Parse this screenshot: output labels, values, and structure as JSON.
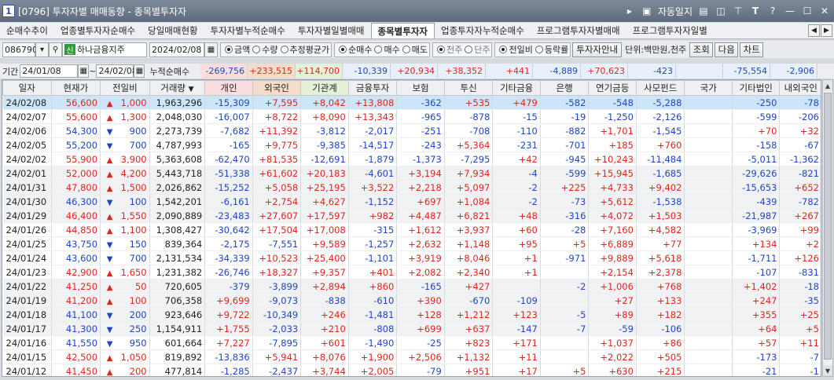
{
  "window": {
    "number": "1",
    "title": "[0796] 투자자별 매매동향 - 종목별투자자",
    "autosave_label": "자동일지",
    "icons": [
      "play-icon",
      "screen-icon",
      "layout-icon",
      "split-icon",
      "pin-icon",
      "font-icon",
      "help-icon",
      "minimize-icon",
      "maximize-icon",
      "close-icon"
    ]
  },
  "tabs": [
    {
      "label": "순매수추이",
      "active": false
    },
    {
      "label": "업종별투자자순매수",
      "active": false
    },
    {
      "label": "당일매매현황",
      "active": false
    },
    {
      "label": "투자자별누적순매수",
      "active": false
    },
    {
      "label": "투자자별일별매매",
      "active": false
    },
    {
      "label": "종목별투자자",
      "active": true
    },
    {
      "label": "업종투자자누적순매수",
      "active": false
    },
    {
      "label": "프로그램투자자별매매",
      "active": false
    },
    {
      "label": "프로그램투자자일별",
      "active": false
    }
  ],
  "controls": {
    "stock_code": "086790",
    "credit_badge": "신",
    "stock_name": "하나금융지주",
    "date": "2024/02/08",
    "value_type": [
      {
        "label": "금액",
        "checked": true
      },
      {
        "label": "수량",
        "checked": false
      },
      {
        "label": "추정평균가",
        "checked": false
      }
    ],
    "trade_type": [
      {
        "label": "순매수",
        "checked": true
      },
      {
        "label": "매수",
        "checked": false
      },
      {
        "label": "매도",
        "checked": false
      }
    ],
    "unit_type": [
      {
        "label": "천주",
        "checked": true
      },
      {
        "label": "단주",
        "checked": false
      }
    ],
    "compare_type": [
      {
        "label": "전일비",
        "checked": true
      },
      {
        "label": "등락률",
        "checked": false
      }
    ],
    "investor_guide_button": "투자자안내",
    "unit_label": "단위:백만원,천주",
    "query_button": "조회",
    "next_button": "다음",
    "chart_button": "차트"
  },
  "period": {
    "label": "기간",
    "start": "24/01/08",
    "separator": "~",
    "end": "24/02/08",
    "cumulative_label": "누적순매수"
  },
  "cumulative": {
    "individual": "-269,756",
    "foreign": "+233,515",
    "institution": "+114,700",
    "financial_investment": "-10,339",
    "insurance": "+20,934",
    "trust": "+38,352",
    "other_finance": "+441",
    "bank": "-4,889",
    "pension": "+70,623",
    "private_fund": "-423",
    "nation": "",
    "other_corp": "-75,554",
    "domestic_foreign": "-2,906"
  },
  "columns": [
    "일자",
    "현재가",
    "전일비",
    "거래량",
    "개인",
    "외국인",
    "기관계",
    "금융투자",
    "보험",
    "투신",
    "기타금융",
    "은행",
    "연기금등",
    "사모펀드",
    "국가",
    "기타법인",
    "내외국인"
  ],
  "rows": [
    {
      "date": "24/02/08",
      "price": "56,600",
      "dir": "up",
      "change": "1,000",
      "volume": "1,963,296",
      "ind": "-15,309",
      "frg": "+7,595",
      "inst": "+8,042",
      "fin": "+13,808",
      "ins": "-362",
      "trust": "+535",
      "ofin": "+479",
      "bank": "-582",
      "pens": "-548",
      "priv": "-5,288",
      "nat": "",
      "ocorp": "-250",
      "dfrg": "-78"
    },
    {
      "date": "24/02/07",
      "price": "55,600",
      "dir": "up",
      "change": "1,300",
      "volume": "2,048,030",
      "ind": "-16,007",
      "frg": "+8,722",
      "inst": "+8,090",
      "fin": "+13,343",
      "ins": "-965",
      "trust": "-878",
      "ofin": "-15",
      "bank": "-19",
      "pens": "-1,250",
      "priv": "-2,126",
      "nat": "",
      "ocorp": "-599",
      "dfrg": "-206"
    },
    {
      "date": "24/02/06",
      "price": "54,300",
      "dir": "down",
      "change": "900",
      "volume": "2,273,739",
      "ind": "-7,682",
      "frg": "+11,392",
      "inst": "-3,812",
      "fin": "-2,017",
      "ins": "-251",
      "trust": "-708",
      "ofin": "-110",
      "bank": "-882",
      "pens": "+1,701",
      "priv": "-1,545",
      "nat": "",
      "ocorp": "+70",
      "dfrg": "+32"
    },
    {
      "date": "24/02/05",
      "price": "55,200",
      "dir": "down",
      "change": "700",
      "volume": "4,787,993",
      "ind": "-165",
      "frg": "+9,775",
      "inst": "-9,385",
      "fin": "-14,517",
      "ins": "-243",
      "trust": "+5,364",
      "ofin": "-231",
      "bank": "-701",
      "pens": "+185",
      "priv": "+760",
      "nat": "",
      "ocorp": "-158",
      "dfrg": "-67"
    },
    {
      "date": "24/02/02",
      "price": "55,900",
      "dir": "up",
      "change": "3,900",
      "volume": "5,363,608",
      "ind": "-62,470",
      "frg": "+81,535",
      "inst": "-12,691",
      "fin": "-1,879",
      "ins": "-1,373",
      "trust": "-7,295",
      "ofin": "+42",
      "bank": "-945",
      "pens": "+10,243",
      "priv": "-11,484",
      "nat": "",
      "ocorp": "-5,011",
      "dfrg": "-1,362"
    },
    {
      "date": "24/02/01",
      "price": "52,000",
      "dir": "up",
      "change": "4,200",
      "volume": "5,443,718",
      "ind": "-51,338",
      "frg": "+61,602",
      "inst": "+20,183",
      "fin": "-4,601",
      "ins": "+3,194",
      "trust": "+7,934",
      "ofin": "-4",
      "bank": "-599",
      "pens": "+15,945",
      "priv": "-1,685",
      "nat": "",
      "ocorp": "-29,626",
      "dfrg": "-821"
    },
    {
      "date": "24/01/31",
      "price": "47,800",
      "dir": "up",
      "change": "1,500",
      "volume": "2,026,862",
      "ind": "-15,252",
      "frg": "+5,058",
      "inst": "+25,195",
      "fin": "+3,522",
      "ins": "+2,218",
      "trust": "+5,097",
      "ofin": "-2",
      "bank": "+225",
      "pens": "+4,733",
      "priv": "+9,402",
      "nat": "",
      "ocorp": "-15,653",
      "dfrg": "+652"
    },
    {
      "date": "24/01/30",
      "price": "46,300",
      "dir": "down",
      "change": "100",
      "volume": "1,542,201",
      "ind": "-6,161",
      "frg": "+2,754",
      "inst": "+4,627",
      "fin": "-1,152",
      "ins": "+697",
      "trust": "+1,084",
      "ofin": "-2",
      "bank": "-73",
      "pens": "+5,612",
      "priv": "-1,538",
      "nat": "",
      "ocorp": "-439",
      "dfrg": "-782"
    },
    {
      "date": "24/01/29",
      "price": "46,400",
      "dir": "up",
      "change": "1,550",
      "volume": "2,090,889",
      "ind": "-23,483",
      "frg": "+27,607",
      "inst": "+17,597",
      "fin": "+982",
      "ins": "+4,487",
      "trust": "+6,821",
      "ofin": "+48",
      "bank": "-316",
      "pens": "+4,072",
      "priv": "+1,503",
      "nat": "",
      "ocorp": "-21,987",
      "dfrg": "+267"
    },
    {
      "date": "24/01/26",
      "price": "44,850",
      "dir": "up",
      "change": "1,100",
      "volume": "1,308,427",
      "ind": "-30,642",
      "frg": "+17,504",
      "inst": "+17,008",
      "fin": "-315",
      "ins": "+1,612",
      "trust": "+3,937",
      "ofin": "+60",
      "bank": "-28",
      "pens": "+7,160",
      "priv": "+4,582",
      "nat": "",
      "ocorp": "-3,969",
      "dfrg": "+99"
    },
    {
      "date": "24/01/25",
      "price": "43,750",
      "dir": "down",
      "change": "150",
      "volume": "839,364",
      "ind": "-2,175",
      "frg": "-7,551",
      "inst": "+9,589",
      "fin": "-1,257",
      "ins": "+2,632",
      "trust": "+1,148",
      "ofin": "+95",
      "bank": "+5",
      "pens": "+6,889",
      "priv": "+77",
      "nat": "",
      "ocorp": "+134",
      "dfrg": "+2"
    },
    {
      "date": "24/01/24",
      "price": "43,600",
      "dir": "down",
      "change": "700",
      "volume": "2,131,534",
      "ind": "-34,339",
      "frg": "+10,523",
      "inst": "+25,400",
      "fin": "-1,101",
      "ins": "+3,919",
      "trust": "+8,046",
      "ofin": "+1",
      "bank": "-971",
      "pens": "+9,889",
      "priv": "+5,618",
      "nat": "",
      "ocorp": "-1,711",
      "dfrg": "+126"
    },
    {
      "date": "24/01/23",
      "price": "42,900",
      "dir": "up",
      "change": "1,650",
      "volume": "1,231,382",
      "ind": "-26,746",
      "frg": "+18,327",
      "inst": "+9,357",
      "fin": "+401",
      "ins": "+2,082",
      "trust": "+2,340",
      "ofin": "+1",
      "bank": "",
      "pens": "+2,154",
      "priv": "+2,378",
      "nat": "",
      "ocorp": "-107",
      "dfrg": "-831"
    },
    {
      "date": "24/01/22",
      "price": "41,250",
      "dir": "up",
      "change": "50",
      "volume": "720,605",
      "ind": "-379",
      "frg": "-3,899",
      "inst": "+2,894",
      "fin": "+860",
      "ins": "-165",
      "trust": "+427",
      "ofin": "",
      "bank": "-2",
      "pens": "+1,006",
      "priv": "+768",
      "nat": "",
      "ocorp": "+1,402",
      "dfrg": "-18"
    },
    {
      "date": "24/01/19",
      "price": "41,200",
      "dir": "up",
      "change": "100",
      "volume": "706,358",
      "ind": "+9,699",
      "frg": "-9,073",
      "inst": "-838",
      "fin": "-610",
      "ins": "+390",
      "trust": "-670",
      "ofin": "-109",
      "bank": "",
      "pens": "+27",
      "priv": "+133",
      "nat": "",
      "ocorp": "+247",
      "dfrg": "-35"
    },
    {
      "date": "24/01/18",
      "price": "41,100",
      "dir": "down",
      "change": "200",
      "volume": "923,646",
      "ind": "+9,722",
      "frg": "-10,349",
      "inst": "+246",
      "fin": "-1,481",
      "ins": "+128",
      "trust": "+1,212",
      "ofin": "+123",
      "bank": "-5",
      "pens": "+89",
      "priv": "+182",
      "nat": "",
      "ocorp": "+355",
      "dfrg": "+25"
    },
    {
      "date": "24/01/17",
      "price": "41,300",
      "dir": "down",
      "change": "250",
      "volume": "1,154,911",
      "ind": "+1,755",
      "frg": "-2,033",
      "inst": "+210",
      "fin": "-808",
      "ins": "+699",
      "trust": "+637",
      "ofin": "-147",
      "bank": "-7",
      "pens": "-59",
      "priv": "-106",
      "nat": "",
      "ocorp": "+64",
      "dfrg": "+5"
    },
    {
      "date": "24/01/16",
      "price": "41,550",
      "dir": "down",
      "change": "950",
      "volume": "601,664",
      "ind": "+7,227",
      "frg": "-7,895",
      "inst": "+601",
      "fin": "-1,490",
      "ins": "-25",
      "trust": "+823",
      "ofin": "+171",
      "bank": "",
      "pens": "+1,037",
      "priv": "+86",
      "nat": "",
      "ocorp": "+57",
      "dfrg": "+11"
    },
    {
      "date": "24/01/15",
      "price": "42,500",
      "dir": "up",
      "change": "1,050",
      "volume": "819,892",
      "ind": "-13,836",
      "frg": "+5,941",
      "inst": "+8,076",
      "fin": "+1,900",
      "ins": "+2,506",
      "trust": "+1,132",
      "ofin": "+11",
      "bank": "",
      "pens": "+2,022",
      "priv": "+505",
      "nat": "",
      "ocorp": "-173",
      "dfrg": "-7"
    },
    {
      "date": "24/01/12",
      "price": "41,450",
      "dir": "up",
      "change": "200",
      "volume": "477,814",
      "ind": "-1,285",
      "frg": "-2,437",
      "inst": "+3,744",
      "fin": "+2,005",
      "ins": "-79",
      "trust": "+951",
      "ofin": "+17",
      "bank": "+5",
      "pens": "+630",
      "priv": "+215",
      "nat": "",
      "ocorp": "-21",
      "dfrg": "-1"
    }
  ],
  "colors": {
    "up": "#e0241c",
    "down": "#1f44c8",
    "selected_row": "#cde6f7",
    "header_pink": "#f9dedd",
    "header_green": "#e3f1d9"
  }
}
